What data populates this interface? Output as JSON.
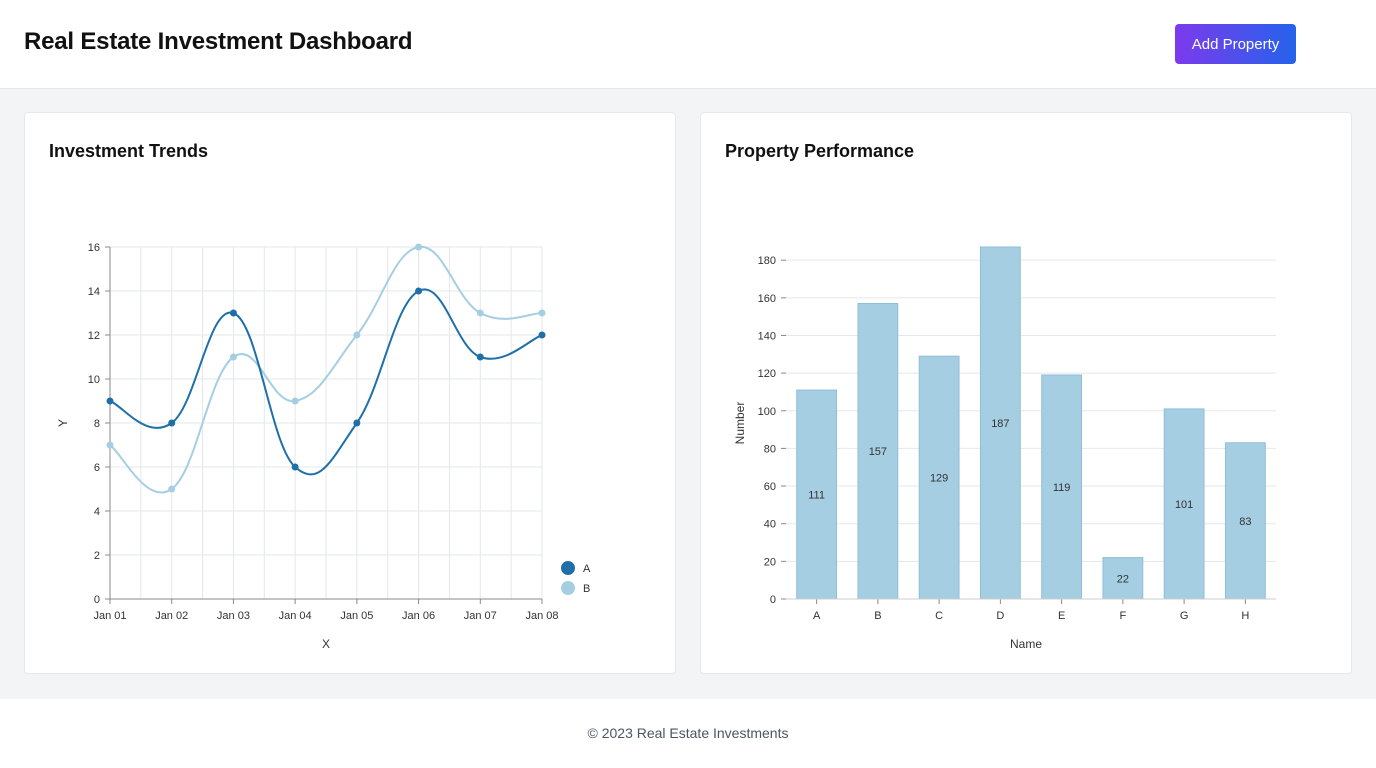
{
  "header": {
    "title": "Real Estate Investment Dashboard",
    "add_button_label": "Add Property"
  },
  "cards": {
    "trends_title": "Investment Trends",
    "performance_title": "Property Performance"
  },
  "footer": {
    "text": "© 2023 Real Estate Investments"
  },
  "colors": {
    "series_a": "#1f6fa8",
    "series_b": "#a6cee3",
    "bar_fill": "#a6cee3",
    "button_gradient_start": "#7c3aed",
    "button_gradient_end": "#2563eb"
  },
  "chart_data": [
    {
      "type": "line",
      "x": [
        "Jan 01",
        "Jan 02",
        "Jan 03",
        "Jan 04",
        "Jan 05",
        "Jan 06",
        "Jan 07",
        "Jan 08"
      ],
      "series": [
        {
          "name": "A",
          "values": [
            9,
            8,
            13,
            6,
            8,
            14,
            11,
            12
          ]
        },
        {
          "name": "B",
          "values": [
            7,
            5,
            11,
            9,
            12,
            16,
            13,
            13
          ]
        }
      ],
      "xlabel": "X",
      "ylabel": "Y",
      "ylim": [
        0,
        16
      ],
      "yticks": [
        0,
        2,
        4,
        6,
        8,
        10,
        12,
        14,
        16
      ],
      "grid": true,
      "legend": "bottom-right"
    },
    {
      "type": "bar",
      "categories": [
        "A",
        "B",
        "C",
        "D",
        "E",
        "F",
        "G",
        "H"
      ],
      "values": [
        111,
        157,
        129,
        187,
        119,
        22,
        101,
        83
      ],
      "xlabel": "Name",
      "ylabel": "Number",
      "ylim": [
        0,
        180
      ],
      "yticks": [
        0,
        20,
        40,
        60,
        80,
        100,
        120,
        140,
        160,
        180
      ],
      "grid": true,
      "data_labels": true
    }
  ]
}
